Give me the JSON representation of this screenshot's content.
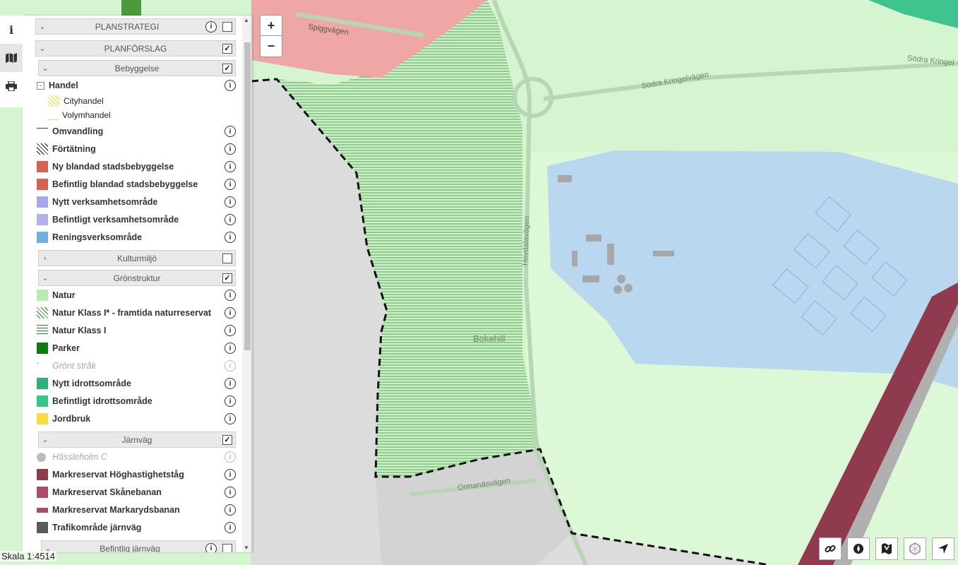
{
  "map": {
    "labels": {
      "spiggvagen": "Spiggvägen",
      "sodra_kringelvagen_1": "Södra Kringelvägen",
      "sodra_kringelvagen_2": "Södra Kringel",
      "hovdalavagen": "Hovdalavägen",
      "bokehill": "Bokehill",
      "ormanasvagen": "Ormanäsvägen"
    },
    "colors": {
      "natur": "#d4f5cf",
      "residential": "#e8a3a1",
      "industrial": "#b9d8f0",
      "railway": "#8f3a4e",
      "water": "#dcdcdc",
      "hatch": "#2f9c2f"
    }
  },
  "zoom": {
    "in": "+",
    "out": "−"
  },
  "scale": {
    "text": "Skala 1:4514"
  },
  "toolbar": {
    "icons": [
      "info-icon",
      "map-icon",
      "print-icon"
    ]
  },
  "legend": {
    "planstrategi": {
      "label": "PLANSTRATEGI",
      "checked": false
    },
    "planforslag": {
      "label": "PLANFÖRSLAG",
      "checked": true
    },
    "bebyggelse": {
      "label": "Bebyggelse",
      "checked": true
    },
    "handel": {
      "label": "Handel",
      "toggle": "-"
    },
    "handel_sub": [
      {
        "label": "Cityhandel"
      },
      {
        "label": "Volymhandel"
      }
    ],
    "bebyggelse_items": [
      {
        "label": "Omvandling",
        "color": "#ffffff"
      },
      {
        "label": "Förtätning",
        "color": "#ffffff"
      },
      {
        "label": "Ny blandad stadsbebyggelse",
        "color": "#d9614f"
      },
      {
        "label": "Befintlig blandad stadsbebyggelse",
        "color": "#d9614f"
      },
      {
        "label": "Nytt verksamhetsområde",
        "color": "#a9a6ec"
      },
      {
        "label": "Befintligt verksamhetsområde",
        "color": "#b3b0f0"
      },
      {
        "label": "Reningsverksområde",
        "color": "#6fb0e0"
      }
    ],
    "kulturmiljo": {
      "label": "Kulturmiljö",
      "checked": false
    },
    "gronstruktur": {
      "label": "Grönstruktur",
      "checked": true
    },
    "gronstruktur_items": [
      {
        "label": "Natur",
        "color": "#b6ecb0"
      },
      {
        "label": "Natur Klass I* - framtida naturreservat",
        "color": "#ffffff"
      },
      {
        "label": "Natur Klass I",
        "color": "#ffffff"
      },
      {
        "label": "Parker",
        "color": "#0c7a0c"
      },
      {
        "label": "Grönt stråk",
        "color": "#ffffff"
      },
      {
        "label": "Nytt idrottsområde",
        "color": "#2fb07a"
      },
      {
        "label": "Befintligt idrottsområde",
        "color": "#36c68a"
      },
      {
        "label": "Jordbruk",
        "color": "#f7dc3c"
      }
    ],
    "jarnvag": {
      "label": "Järnväg",
      "checked": true
    },
    "jarnvag_items": [
      {
        "label": "Hässleholm C",
        "color": "#bbbbbb"
      },
      {
        "label": "Markreservat Höghastighetståg",
        "color": "#8f3a4e"
      },
      {
        "label": "Markreservat Skånebanan",
        "color": "#b04b66"
      },
      {
        "label": "Markreservat Markarydsbanan",
        "color": "#b04b66"
      },
      {
        "label": "Trafikområde järnväg",
        "color": "#5a5a5a"
      }
    ],
    "befintlig_jarnvag": {
      "label": "Befintlig järnväg",
      "checked": false
    }
  },
  "tools": [
    "link-icon",
    "compass-icon",
    "map-layers-icon",
    "polygon-icon",
    "locate-icon"
  ]
}
